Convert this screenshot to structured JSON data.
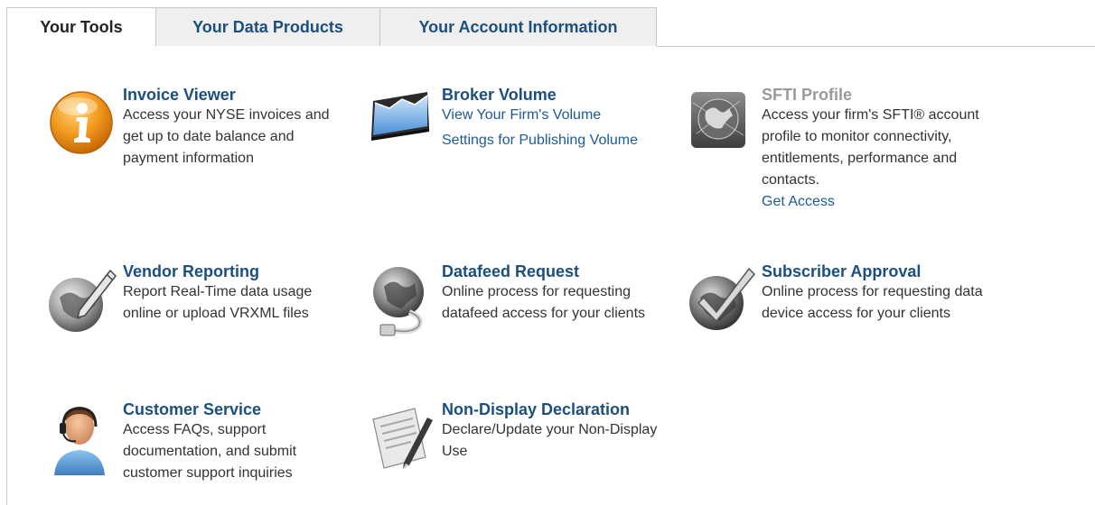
{
  "tabs": [
    {
      "label": "Your Tools",
      "active": true
    },
    {
      "label": "Your Data Products",
      "active": false
    },
    {
      "label": "Your Account Information",
      "active": false
    }
  ],
  "tools": {
    "invoice_viewer": {
      "title": "Invoice Viewer",
      "description": "Access your NYSE invoices and get up to date balance and payment information",
      "icon": "info-icon"
    },
    "broker_volume": {
      "title": "Broker Volume",
      "links": [
        "View Your Firm's Volume",
        "Settings for Publishing Volume"
      ],
      "icon": "volume-chart-icon"
    },
    "sfti_profile": {
      "title": "SFTI Profile",
      "description": "Access your firm's SFTI® account profile to monitor connectivity, entitlements, performance and contacts.",
      "link": "Get Access",
      "icon": "globe-network-icon"
    },
    "vendor_reporting": {
      "title": "Vendor Reporting",
      "description": "Report Real-Time data usage online or upload VRXML files",
      "icon": "globe-pen-icon"
    },
    "datafeed_request": {
      "title": "Datafeed Request",
      "description": "Online process for requesting datafeed access for your clients",
      "icon": "globe-cable-icon"
    },
    "subscriber_approval": {
      "title": "Subscriber Approval",
      "description": "Online process for requesting data device access for your clients",
      "icon": "globe-checkmark-icon"
    },
    "customer_service": {
      "title": "Customer Service",
      "description": "Access FAQs, support documentation, and submit customer support inquiries",
      "icon": "headset-agent-icon"
    },
    "non_display_declaration": {
      "title": "Non-Display Declaration",
      "description": "Declare/Update your Non-Display Use",
      "icon": "document-pen-icon"
    }
  },
  "colors": {
    "link_blue": "#1b4f80",
    "disabled_gray": "#9a9a9a",
    "tab_inactive_bg": "#efefef",
    "border": "#c8c8c8"
  }
}
